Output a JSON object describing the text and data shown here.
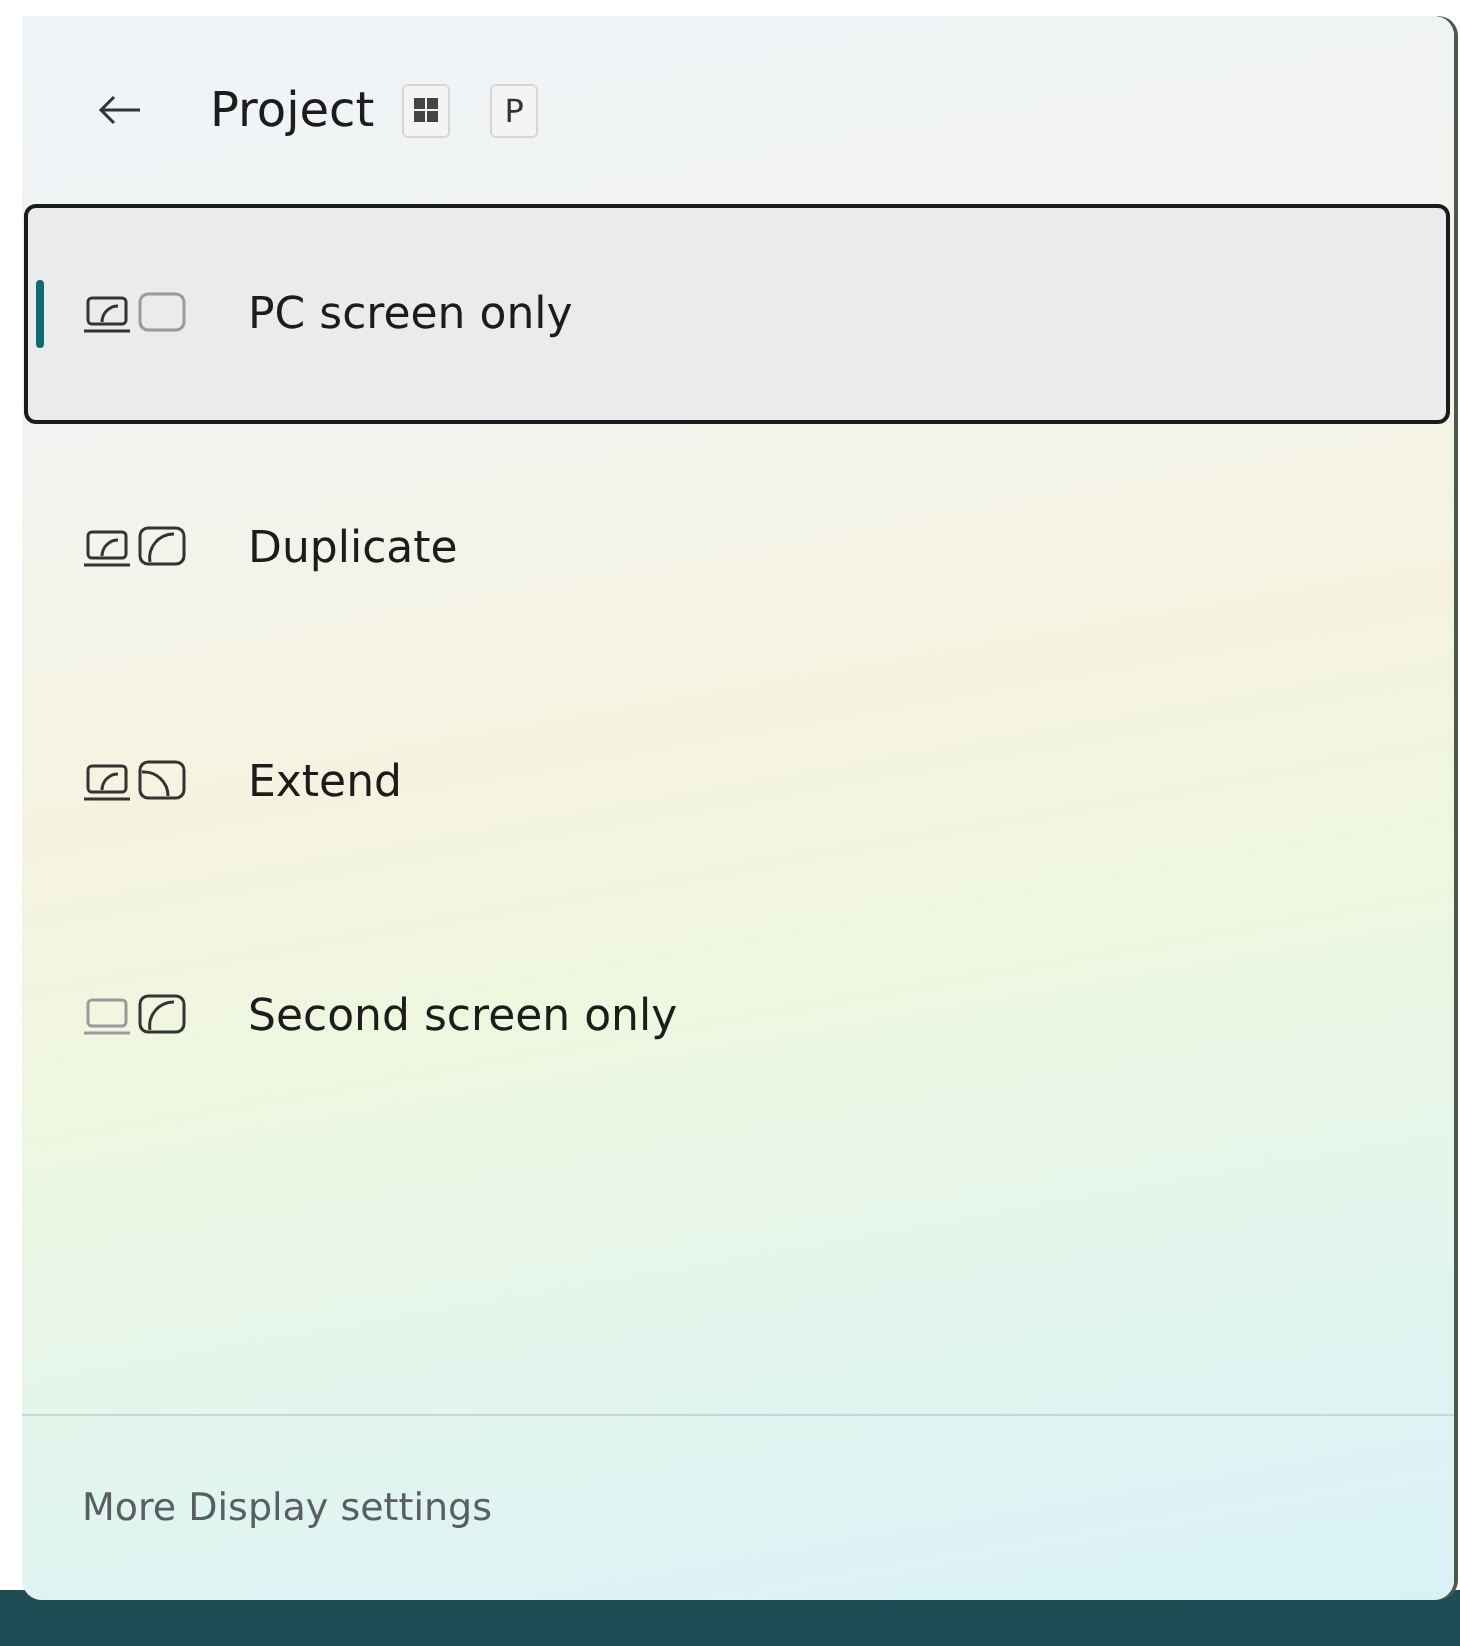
{
  "header": {
    "title": "Project",
    "shortcut": [
      {
        "kind": "windows"
      },
      {
        "kind": "key",
        "label": "P"
      }
    ]
  },
  "options": [
    {
      "kind": "pc-only",
      "label": "PC screen only",
      "selected": true
    },
    {
      "kind": "duplicate",
      "label": "Duplicate",
      "selected": false
    },
    {
      "kind": "extend",
      "label": "Extend",
      "selected": false
    },
    {
      "kind": "second-only",
      "label": "Second screen only",
      "selected": false
    }
  ],
  "footer": {
    "link": "More Display settings"
  }
}
